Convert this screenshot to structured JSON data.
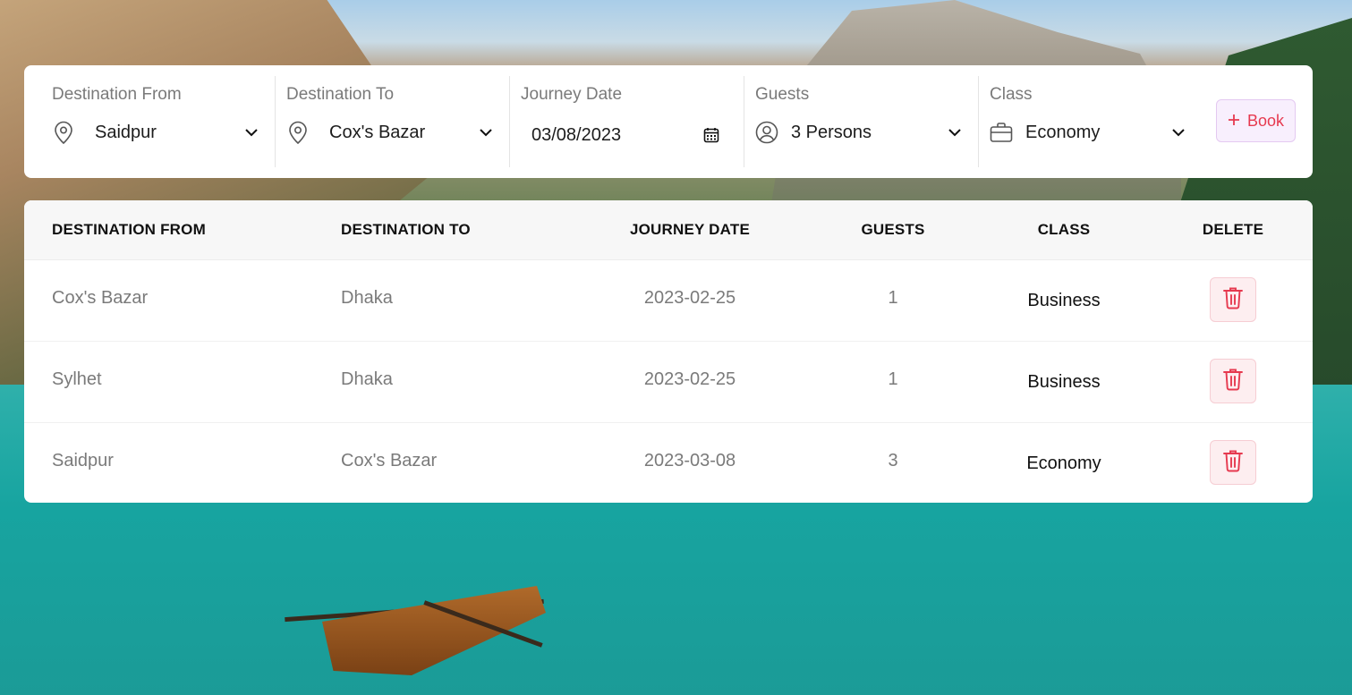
{
  "search": {
    "from": {
      "label": "Destination From",
      "value": "Saidpur",
      "icon": "location-pin-icon"
    },
    "to": {
      "label": "Destination To",
      "value": "Cox's Bazar",
      "icon": "location-pin-icon"
    },
    "date": {
      "label": "Journey Date",
      "value": "03/08/2023",
      "icon": "calendar-icon"
    },
    "guests": {
      "label": "Guests",
      "value": "3 Persons",
      "icon": "user-circle-icon"
    },
    "class": {
      "label": "Class",
      "value": "Economy",
      "icon": "briefcase-icon"
    },
    "book_label": "Book"
  },
  "table": {
    "headers": [
      "DESTINATION FROM",
      "DESTINATION TO",
      "JOURNEY DATE",
      "GUESTS",
      "CLASS",
      "DELETE"
    ],
    "rows": [
      {
        "from": "Cox's Bazar",
        "to": "Dhaka",
        "date": "2023-02-25",
        "guests": "1",
        "class": "Business"
      },
      {
        "from": "Sylhet",
        "to": "Dhaka",
        "date": "2023-02-25",
        "guests": "1",
        "class": "Business"
      },
      {
        "from": "Saidpur",
        "to": "Cox's Bazar",
        "date": "2023-03-08",
        "guests": "3",
        "class": "Economy"
      }
    ]
  },
  "colors": {
    "accent": "#e6394f",
    "book_bg": "#f8effd",
    "delete_bg": "#fdeef0"
  }
}
